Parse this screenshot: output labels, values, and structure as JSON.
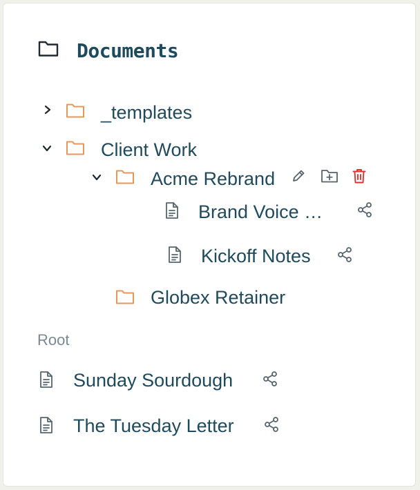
{
  "header": {
    "title": "Documents",
    "icon": "folder-outline-icon"
  },
  "tree": {
    "templates": {
      "label": "_templates",
      "expanded": false
    },
    "client_work": {
      "label": "Client Work",
      "expanded": true
    },
    "acme": {
      "label": "Acme Rebrand",
      "expanded": true,
      "actions": [
        "pencil-icon",
        "folder-plus-icon",
        "trash-icon"
      ]
    },
    "brand_voice": {
      "label": "Brand Voice Guidelines"
    },
    "kickoff": {
      "label": "Kickoff Notes"
    },
    "globex": {
      "label": "Globex Retainer"
    }
  },
  "root": {
    "section_label": "Root",
    "items": [
      {
        "label": "Sunday Sourdough"
      },
      {
        "label": "The Tuesday Letter"
      }
    ]
  },
  "colors": {
    "text": "#1f4a5c",
    "folder": "#e8955a",
    "muted": "#7a8a93",
    "danger": "#e03131"
  }
}
